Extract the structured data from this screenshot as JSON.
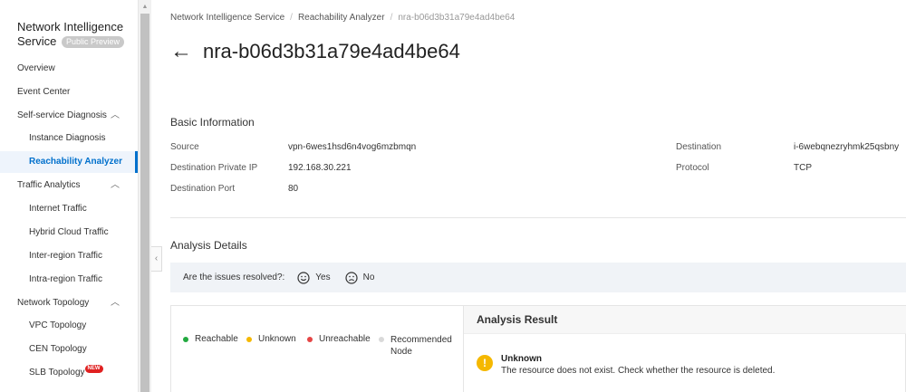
{
  "sidebar": {
    "title": "Network Intelligence Service",
    "badge": "Public Preview",
    "items": [
      {
        "label": "Overview"
      },
      {
        "label": "Event Center"
      },
      {
        "label": "Self-service Diagnosis"
      },
      {
        "label": "Instance Diagnosis"
      },
      {
        "label": "Reachability Analyzer"
      },
      {
        "label": "Traffic Analytics"
      },
      {
        "label": "Internet Traffic"
      },
      {
        "label": "Hybrid Cloud Traffic"
      },
      {
        "label": "Inter-region Traffic"
      },
      {
        "label": "Intra-region Traffic"
      },
      {
        "label": "Network Topology"
      },
      {
        "label": "VPC Topology"
      },
      {
        "label": "CEN Topology"
      },
      {
        "label": "SLB Topology"
      }
    ],
    "new_badge": "NEW"
  },
  "breadcrumb": [
    "Network Intelligence Service",
    "Reachability Analyzer",
    "nra-b06d3b31a79e4ad4be64"
  ],
  "page_title": "nra-b06d3b31a79e4ad4be64",
  "basic_info": {
    "heading": "Basic Information",
    "source_label": "Source",
    "source_value": "vpn-6wes1hsd6n4vog6mzbmqn",
    "dest_label": "Destination",
    "dest_value": "i-6webqnezryhmk25qsbny",
    "dest_ip_label": "Destination Private IP",
    "dest_ip_value": "192.168.30.221",
    "protocol_label": "Protocol",
    "protocol_value": "TCP",
    "dest_port_label": "Destination Port",
    "dest_port_value": "80"
  },
  "analysis": {
    "heading": "Analysis Details",
    "feedback_question": "Are the issues resolved?:",
    "yes_label": "Yes",
    "no_label": "No",
    "legend": [
      {
        "label": "Reachable",
        "color": "#22a93f"
      },
      {
        "label": "Unknown",
        "color": "#f5b800"
      },
      {
        "label": "Unreachable",
        "color": "#e54545"
      },
      {
        "label": "Recommended Node",
        "color": "#d9d9d9"
      }
    ],
    "result_heading": "Analysis Result",
    "result_title": "Unknown",
    "result_message": "The resource does not exist. Check whether the resource is deleted.",
    "warn_glyph": "!"
  }
}
